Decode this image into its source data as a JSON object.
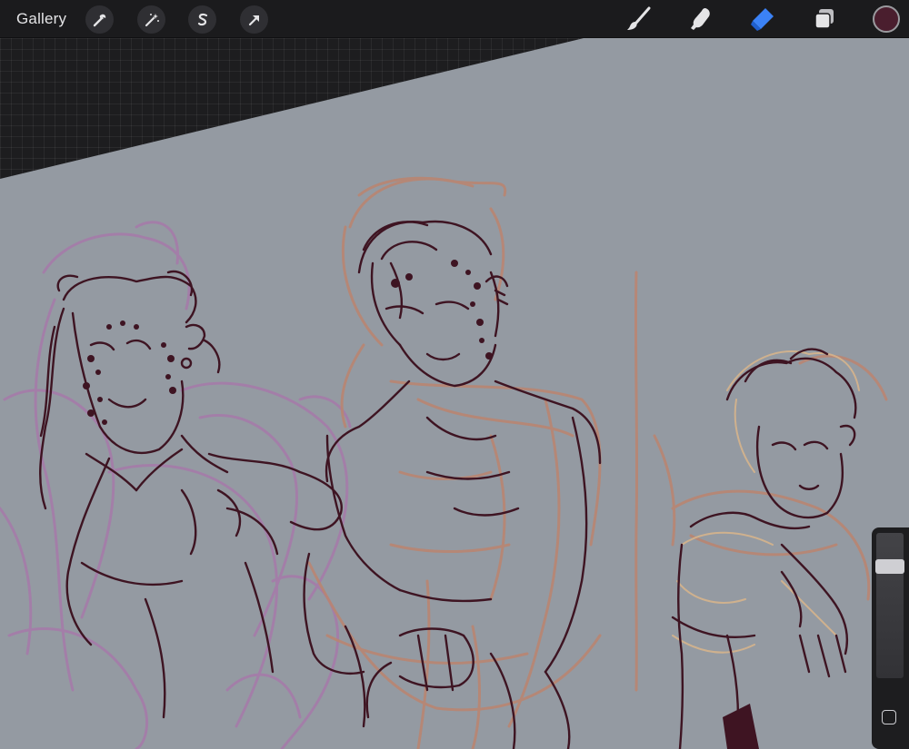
{
  "topbar": {
    "gallery_label": "Gallery",
    "left_tools": [
      {
        "name": "actions",
        "icon": "wrench-icon"
      },
      {
        "name": "adjustments",
        "icon": "magic-wand-icon"
      },
      {
        "name": "selection",
        "icon": "selection-s-icon"
      },
      {
        "name": "transform",
        "icon": "arrow-cursor-icon"
      }
    ],
    "right_tools": [
      {
        "name": "brush",
        "icon": "brush-icon",
        "active": false
      },
      {
        "name": "smudge",
        "icon": "smudge-finger-icon",
        "active": false
      },
      {
        "name": "eraser",
        "icon": "eraser-icon",
        "active": true
      },
      {
        "name": "layers",
        "icon": "layers-icon",
        "active": false
      }
    ],
    "current_color": "#4a1e2e"
  },
  "sidebar": {
    "opacity_level": 0.8,
    "modify_button_icon": "square-outline-icon"
  },
  "colors": {
    "canvas": "#949aa2",
    "accent": "#3b82f6",
    "sketch_dark": "#3e1422",
    "sketch_pink": "#b98572",
    "sketch_purple": "#a67aaa"
  }
}
